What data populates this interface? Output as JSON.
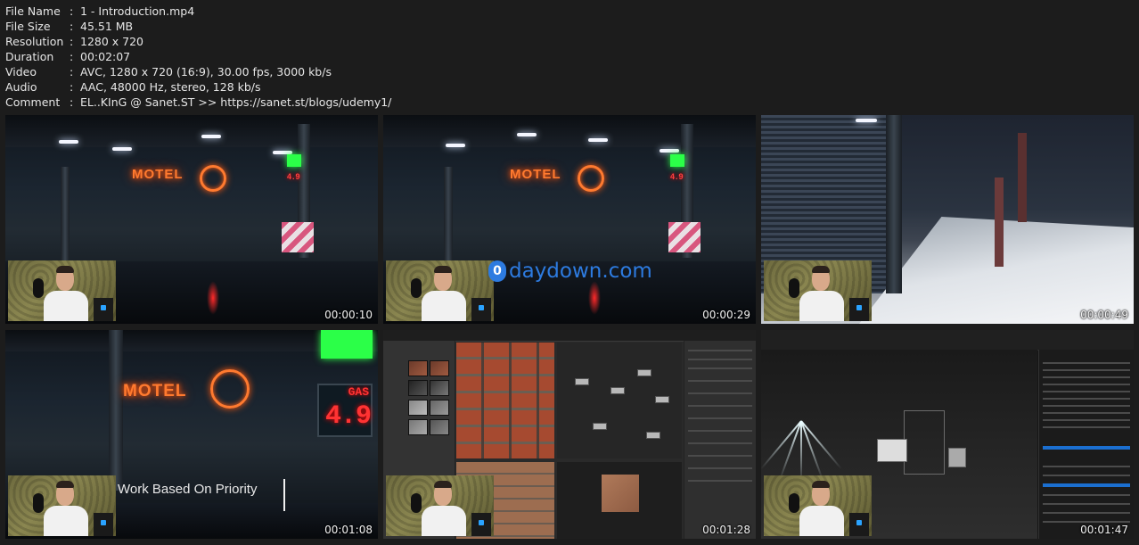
{
  "meta": {
    "rows": [
      {
        "key": "File Name",
        "sep": ":",
        "value": "1 - Introduction.mp4"
      },
      {
        "key": "File Size",
        "sep": ":",
        "value": "45.51 MB"
      },
      {
        "key": "Resolution",
        "sep": ":",
        "value": "1280 x 720"
      },
      {
        "key": "Duration",
        "sep": ":",
        "value": "00:02:07"
      },
      {
        "key": "Video",
        "sep": ":",
        "value": "AVC, 1280 x 720 (16:9), 30.00 fps, 3000 kb/s"
      },
      {
        "key": "Audio",
        "sep": ":",
        "value": "AAC, 48000 Hz, stereo, 128 kb/s"
      },
      {
        "key": "Comment",
        "sep": ":",
        "value": "EL..KInG @ Sanet.ST >> https://sanet.st/blogs/udemy1/"
      }
    ]
  },
  "thumbnails": [
    {
      "timestamp": "00:00:10",
      "sign": "MOTEL",
      "sign_number": "4.9"
    },
    {
      "timestamp": "00:00:29",
      "sign": "MOTEL",
      "sign_number": "4.9",
      "watermark": {
        "badge": "0",
        "text": "daydown.com"
      }
    },
    {
      "timestamp": "00:00:49"
    },
    {
      "timestamp": "00:01:08",
      "sign": "MOTEL",
      "gas_label": "GAS",
      "gas_price": "4.9",
      "caption": "Work Based On Priority"
    },
    {
      "timestamp": "00:01:28"
    },
    {
      "timestamp": "00:01:47"
    }
  ],
  "colors": {
    "background": "#1c1c1c",
    "text": "#e6e6e6",
    "neon_orange": "#ff7a2f",
    "neon_green": "#2bff48",
    "neon_red": "#ff3333",
    "watermark_blue": "#2d7be0"
  }
}
